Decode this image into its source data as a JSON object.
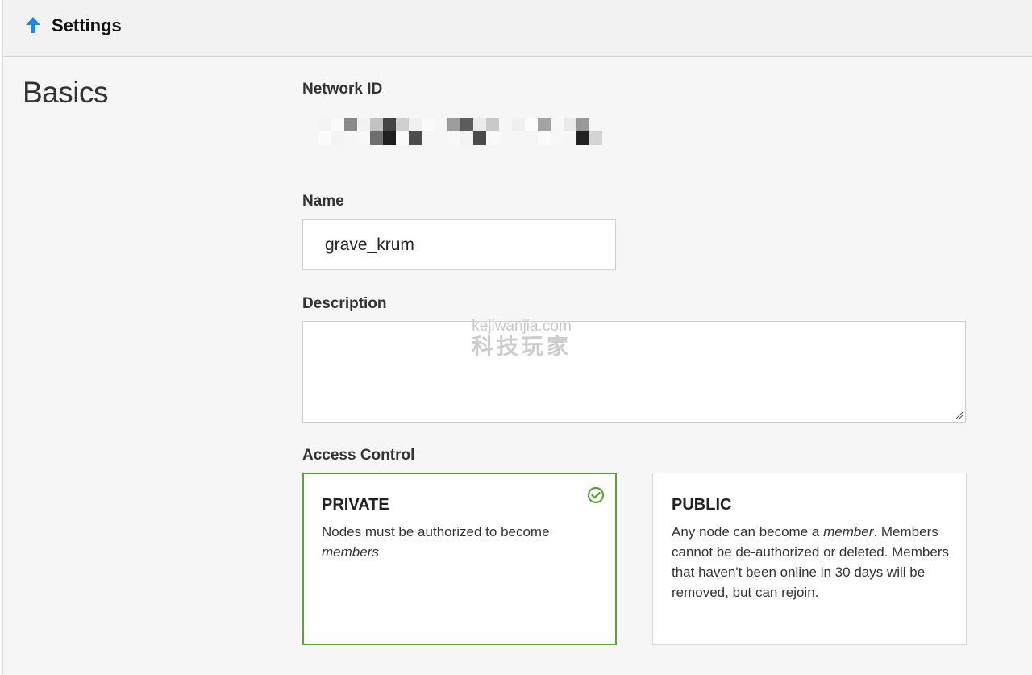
{
  "header": {
    "title": "Settings",
    "back_icon": "arrow-up-icon",
    "accent_color": "#1e88e5"
  },
  "section": {
    "title": "Basics"
  },
  "network_id": {
    "label": "Network ID"
  },
  "name": {
    "label": "Name",
    "value": "grave_krum"
  },
  "description": {
    "label": "Description",
    "value": ""
  },
  "watermark": {
    "url": "kejiwanjia.com",
    "text": "科技玩家"
  },
  "access_control": {
    "label": "Access Control",
    "selected": "private",
    "selected_color": "#5aa531",
    "options": [
      {
        "id": "private",
        "title": "PRIVATE",
        "desc_prefix": "Nodes must be authorized to become ",
        "desc_em": "members",
        "desc_suffix": ""
      },
      {
        "id": "public",
        "title": "PUBLIC",
        "desc_prefix": "Any node can become a ",
        "desc_em": "member",
        "desc_suffix": ". Members cannot be de-authorized or deleted. Members that haven't been online in 30 days will be removed, but can rejoin."
      }
    ]
  }
}
